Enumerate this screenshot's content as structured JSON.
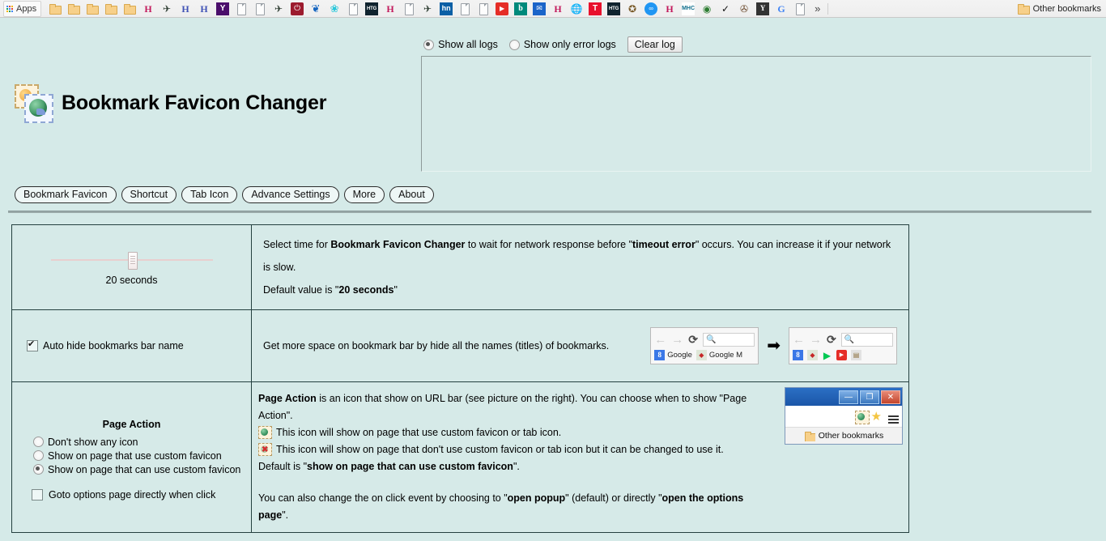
{
  "browser": {
    "apps_label": "Apps",
    "bookmarks": [
      {
        "icon": "folder-icon",
        "kind": "folder",
        "label": ""
      },
      {
        "icon": "folder-icon",
        "kind": "folder",
        "label": ""
      },
      {
        "icon": "folder-icon",
        "kind": "folder",
        "label": ""
      },
      {
        "icon": "folder-icon",
        "kind": "folder",
        "label": ""
      },
      {
        "icon": "folder-icon",
        "kind": "folder",
        "label": ""
      },
      {
        "icon": "h-pink-icon",
        "kind": "htext",
        "label": "H"
      },
      {
        "icon": "plane-icon",
        "kind": "plane",
        "label": "✈"
      },
      {
        "icon": "h-blue-icon",
        "kind": "hblue",
        "label": "H"
      },
      {
        "icon": "h-blue-icon",
        "kind": "hblue",
        "label": "H"
      },
      {
        "icon": "yahoo-icon",
        "kind": "ybox",
        "label": "Y"
      },
      {
        "icon": "document-icon",
        "kind": "doc",
        "label": ""
      },
      {
        "icon": "document-icon",
        "kind": "doc",
        "label": ""
      },
      {
        "icon": "plane-icon",
        "kind": "plane",
        "label": "✈"
      },
      {
        "icon": "power-icon",
        "kind": "power",
        "label": "⏻"
      },
      {
        "icon": "leaf-icon",
        "kind": "leaf",
        "label": "❦"
      },
      {
        "icon": "flower-icon",
        "kind": "flower",
        "label": "❀"
      },
      {
        "icon": "document-icon",
        "kind": "doc",
        "label": ""
      },
      {
        "icon": "htg-icon",
        "kind": "htg",
        "label": "HTG"
      },
      {
        "icon": "h-pink-icon",
        "kind": "htext",
        "label": "H"
      },
      {
        "icon": "document-icon",
        "kind": "doc",
        "label": ""
      },
      {
        "icon": "plane-icon",
        "kind": "plane",
        "label": "✈"
      },
      {
        "icon": "hn-icon",
        "kind": "hn",
        "label": "hn"
      },
      {
        "icon": "document-icon",
        "kind": "doc",
        "label": ""
      },
      {
        "icon": "document-icon",
        "kind": "doc",
        "label": ""
      },
      {
        "icon": "youtube-icon",
        "kind": "yt",
        "label": "▶"
      },
      {
        "icon": "bing-icon",
        "kind": "bing",
        "label": "b"
      },
      {
        "icon": "blue-square-icon",
        "kind": "blue-sq",
        "label": "✉"
      },
      {
        "icon": "h-pink-icon",
        "kind": "htext",
        "label": "H"
      },
      {
        "icon": "chrome-icon",
        "kind": "chrome-ish",
        "label": "🌐"
      },
      {
        "icon": "t-red-icon",
        "kind": "tbox",
        "label": "T"
      },
      {
        "icon": "htg-icon",
        "kind": "htg",
        "label": "HTG"
      },
      {
        "icon": "compass-icon",
        "kind": "compass",
        "label": "✪"
      },
      {
        "icon": "dd-icon",
        "kind": "dd",
        "label": "∞"
      },
      {
        "icon": "h-pink-icon",
        "kind": "htext",
        "label": "H"
      },
      {
        "icon": "mhc-icon",
        "kind": "mhc",
        "label": "MHC"
      },
      {
        "icon": "globe-icon",
        "kind": "globe",
        "label": "◉"
      },
      {
        "icon": "check-icon",
        "kind": "check",
        "label": "✓"
      },
      {
        "icon": "stamp-icon",
        "kind": "stamp",
        "label": "✇"
      },
      {
        "icon": "yahoo-dark-icon",
        "kind": "ydark",
        "label": "Y"
      },
      {
        "icon": "google-icon",
        "kind": "gcolor",
        "label": "G"
      },
      {
        "icon": "document-icon",
        "kind": "doc",
        "label": ""
      }
    ],
    "overflow_label": "»",
    "other_bookmarks_label": "Other bookmarks"
  },
  "log": {
    "show_all_label": "Show all logs",
    "show_all_selected": true,
    "show_errors_label": "Show only error logs",
    "show_errors_selected": false,
    "clear_label": "Clear log",
    "content": ""
  },
  "header": {
    "title": "Bookmark Favicon Changer",
    "icon": "stamp-globe-icon"
  },
  "tabs": [
    {
      "label": "Bookmark Favicon",
      "name": "tab-bookmark-favicon"
    },
    {
      "label": "Shortcut",
      "name": "tab-shortcut"
    },
    {
      "label": "Tab Icon",
      "name": "tab-tab-icon"
    },
    {
      "label": "Advance Settings",
      "name": "tab-advance-settings"
    },
    {
      "label": "More",
      "name": "tab-more"
    },
    {
      "label": "About",
      "name": "tab-about"
    }
  ],
  "timeout_row": {
    "slider_value_label": "20 seconds",
    "slider_min": 0,
    "slider_max": 40,
    "slider_current": 20,
    "desc_1_prefix": "Select time for ",
    "desc_1_bold": "Bookmark Favicon Changer",
    "desc_1_mid": " to wait for network response before \"",
    "desc_1_bold2": "timeout error",
    "desc_1_suffix": "\" occurs. You can increase it if your network is slow.",
    "desc_2_prefix": "Default value is \"",
    "desc_2_bold": "20 seconds",
    "desc_2_suffix": "\""
  },
  "autohide_row": {
    "checkbox_label": "Auto hide bookmarks bar name",
    "checkbox_checked": true,
    "desc": "Get more space on bookmark bar by hide all the names (titles) of bookmarks.",
    "preview_before": {
      "omnibox_placeholder": "",
      "bookmarks": [
        {
          "icon": "google-icon",
          "label": "Google"
        },
        {
          "icon": "google-maps-icon",
          "label": "Google M"
        }
      ]
    },
    "arrow": "➡",
    "preview_after": {
      "bookmarks": [
        {
          "icon": "google-icon",
          "label": ""
        },
        {
          "icon": "google-maps-icon",
          "label": ""
        },
        {
          "icon": "google-play-icon",
          "label": ""
        },
        {
          "icon": "youtube-icon",
          "label": ""
        },
        {
          "icon": "news-icon",
          "label": ""
        }
      ]
    }
  },
  "page_action_row": {
    "heading": "Page Action",
    "options": [
      {
        "label": "Don't show any icon",
        "selected": false,
        "name": "radio-dont-show-any-icon"
      },
      {
        "label": "Show on page that use custom favicon",
        "selected": false,
        "name": "radio-show-on-page-that-use-custom-favicon"
      },
      {
        "label": "Show on page that can use custom favicon",
        "selected": true,
        "name": "radio-show-on-page-that-can-use-custom-favicon"
      }
    ],
    "goto_options_label": "Goto options page directly when click",
    "goto_options_checked": false,
    "desc_bold_lead": "Page Action",
    "desc_line1": " is an icon that show on URL bar (see picture on the right). You can choose when to show \"Page Action\".",
    "desc_line2": "This icon will show on page that use custom favicon or tab icon.",
    "desc_line3": "This icon will show on page that don't use custom favicon or tab icon but it can be changed to use it.",
    "desc_line4_prefix": "Default is \"",
    "desc_line4_bold": "show on page that can use custom favicon",
    "desc_line4_suffix": "\".",
    "desc_line5_prefix": "You can also change the on click event by choosing to \"",
    "desc_line5_bold1": "open popup",
    "desc_line5_mid": "\" (default) or directly \"",
    "desc_line5_bold2": "open the options page",
    "desc_line5_suffix": "\".",
    "window_mock": {
      "minimize_glyph": "—",
      "maximize_glyph": "❐",
      "close_glyph": "✕",
      "other_bookmarks_label": "Other bookmarks"
    }
  },
  "colors": {
    "page_bg": "#d5eae8",
    "table_border": "#24403f",
    "bookmark_bar_bg": "#f1f1f1",
    "titlebar_blue": "#1b56a8"
  }
}
